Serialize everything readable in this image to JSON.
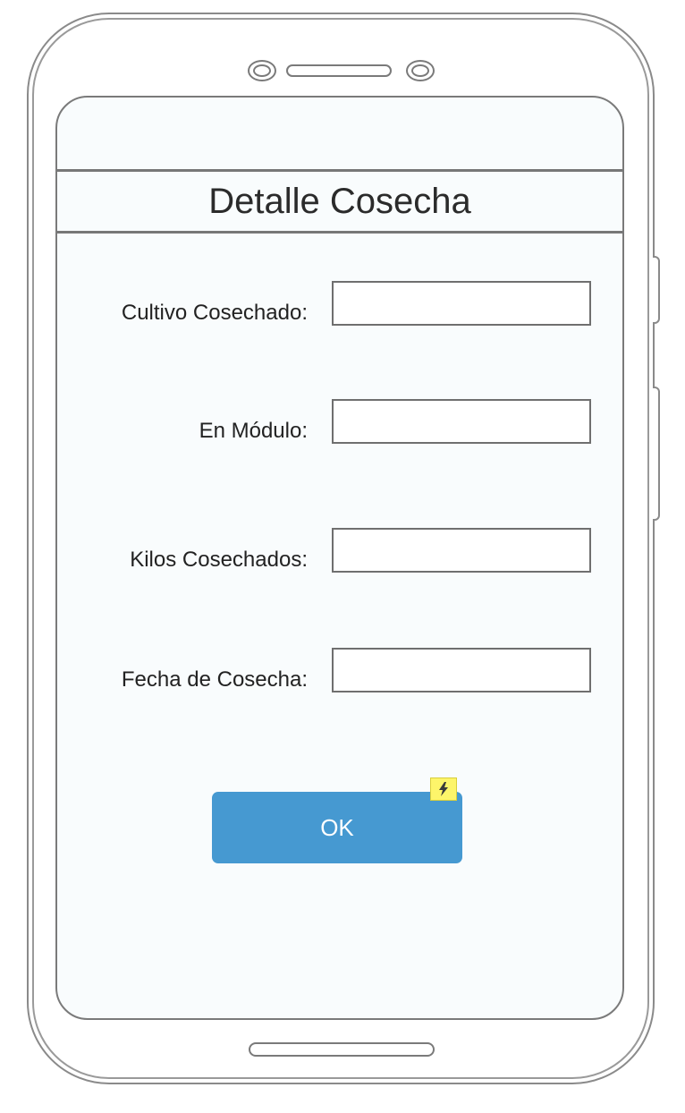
{
  "screen": {
    "title": "Detalle Cosecha",
    "fields": [
      {
        "label": "Cultivo Cosechado:",
        "value": "",
        "placeholder": ""
      },
      {
        "label": "En Módulo:",
        "value": "",
        "placeholder": ""
      },
      {
        "label": "Kilos Cosechados:",
        "value": "",
        "placeholder": ""
      },
      {
        "label": "Fecha de Cosecha:",
        "value": "",
        "placeholder": ""
      }
    ],
    "ok_button": {
      "label": "OK"
    }
  },
  "colors": {
    "button": "#4699d1",
    "screen_background": "#f9fcfd",
    "badge": "#fdf56a"
  },
  "icons": {
    "badge": "lightning-bolt-icon"
  }
}
